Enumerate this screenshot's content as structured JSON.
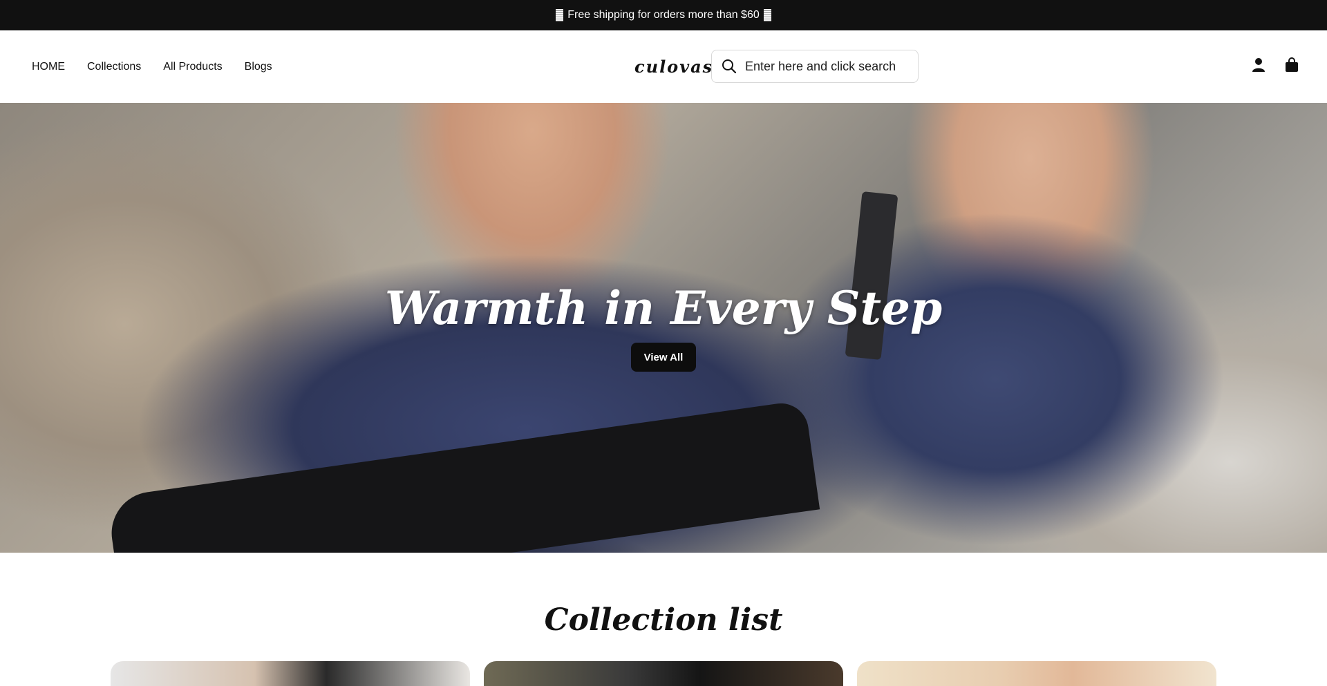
{
  "announcement": {
    "text": "Free shipping for orders more than $60"
  },
  "header": {
    "nav": [
      {
        "label": "HOME"
      },
      {
        "label": "Collections"
      },
      {
        "label": "All Products"
      },
      {
        "label": "Blogs"
      }
    ],
    "logo": "culovas",
    "search": {
      "placeholder": "Enter here and click search",
      "value": ""
    },
    "icons": [
      "user-icon",
      "shopping-bag-icon"
    ]
  },
  "hero": {
    "title": "Warmth in Every Step",
    "button_label": "View All"
  },
  "collections": {
    "title": "Collection list",
    "cards": [
      "collection-card-1",
      "collection-card-2",
      "collection-card-3"
    ]
  },
  "colors": {
    "announcement_bg": "#111111",
    "button_bg": "#0d0d0d",
    "text": "#111111"
  }
}
